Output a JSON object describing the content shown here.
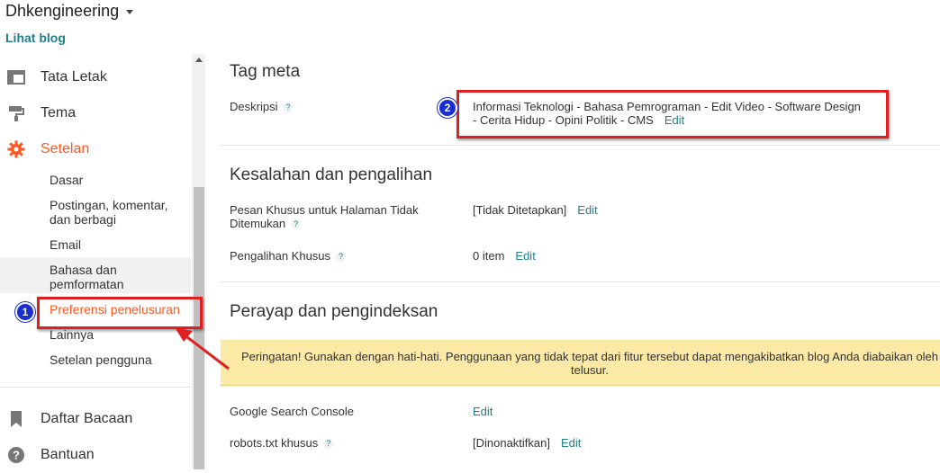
{
  "header": {
    "blog_title": "Dhkengineering",
    "view_blog": "Lihat blog"
  },
  "sidebar": {
    "main": [
      {
        "label": "Tata Letak",
        "icon": "layout-icon"
      },
      {
        "label": "Tema",
        "icon": "paint-roller-icon"
      },
      {
        "label": "Setelan",
        "icon": "gear-icon"
      }
    ],
    "settings_sub": [
      "Dasar",
      "Postingan, komentar,",
      "dan berbagi",
      "Email",
      "Bahasa dan",
      "pemformatan",
      "Preferensi penelusuran",
      "Lainnya",
      "Setelan pengguna"
    ],
    "bottom": [
      {
        "label": "Daftar Bacaan",
        "icon": "bookmark-icon"
      },
      {
        "label": "Bantuan",
        "icon": "help-icon"
      }
    ]
  },
  "main": {
    "meta": {
      "title": "Tag meta",
      "desc_label": "Deskripsi",
      "desc_line1": "Informasi Teknologi - Bahasa Pemrograman - Edit Video - Software Design",
      "desc_line2": "- Cerita Hidup - Opini Politik - CMS",
      "edit": "Edit"
    },
    "errors": {
      "title": "Kesalahan dan pengalihan",
      "custom404_label1": "Pesan Khusus untuk Halaman Tidak",
      "custom404_label2": "Ditemukan",
      "custom404_value": "[Tidak Ditetapkan]",
      "redirect_label": "Pengalihan Khusus",
      "redirect_value": "0 item",
      "edit": "Edit"
    },
    "crawl": {
      "title": "Perayap dan pengindeksan",
      "warning_line1": "Peringatan! Gunakan dengan hati-hati. Penggunaan yang tidak tepat dari fitur tersebut dapat mengakibatkan blog Anda diabaikan oleh",
      "warning_line2": "telusur.",
      "gsc_label": "Google Search Console",
      "robots_label": "robots.txt khusus",
      "robots_value": "[Dinonaktifkan]",
      "edit": "Edit"
    },
    "help_mark": "?"
  },
  "annotations": {
    "badge1": "1",
    "badge2": "2",
    "color": "#e02020",
    "badge_color": "#1a2fd0"
  },
  "colors": {
    "accent": "#ff5722",
    "link": "#217e8b",
    "warning_bg": "#fbe9a5"
  }
}
